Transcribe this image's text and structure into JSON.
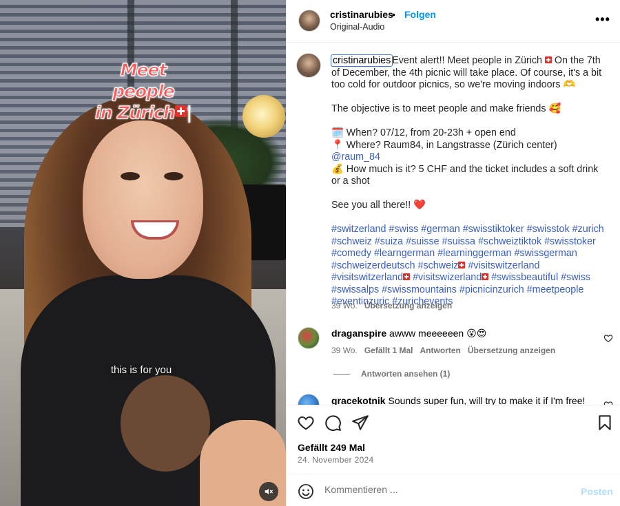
{
  "video": {
    "overlay_title_line1": "Meet people",
    "overlay_title_line2": "in Zürich",
    "overlay_title_suffix": "|",
    "subtitle": "this is for you",
    "mute_icon": "speaker-muted-icon"
  },
  "header": {
    "username": "cristinarubies",
    "separator": "•",
    "follow_label": "Folgen",
    "audio_label": "Original-Audio",
    "more_label": "•••"
  },
  "caption": {
    "username": "cristinarubies",
    "p1_a": "Event alert!! Meet people in Zürich ",
    "p1_b": " On the 7th of December, the 4th picnic will take place. Of course, it's a bit too cold for outdoor picnics, so we're moving indoors 🫶",
    "p2": "The objective is to meet people and make friends 🥰",
    "when": "🗓️ When? 07/12, from 20-23h + open end",
    "where_a": "📍 Where? Raum84, in Langstrasse (Zürich center) ",
    "where_mention": "@raum_84",
    "cost": "💰 How much is it? 5 CHF and the ticket includes a soft drink or a shot",
    "p4": "See you all there!! ❤️",
    "hashtags_1": "#switzerland #swiss #german #swisstiktoker #swisstok #zurich #schweiz #suiza #suisse #suissa #schweiztiktok #swisstoker #comedy #learngerman #learninggerman #swissgerman #schweizerdeutsch #schweiz",
    "hashtags_2": "#visitswitzerland #visitswitzerland",
    "hashtags_3": "#visitswizerland",
    "hashtags_4": "#swissbeautiful #swiss #swissalps #swissmountains #picnicinzurich #meetpeople #eventinzuric #zurichevents",
    "age": "39 Wo.",
    "translate": "Übersetzung anzeigen"
  },
  "comments": [
    {
      "username": "draganspire",
      "text": "awww meeeeeen 😮😍",
      "age": "39 Wo.",
      "likes": "Gefällt 1 Mal",
      "reply": "Antworten",
      "translate": "Übersetzung anzeigen",
      "view_replies": "Antworten ansehen (1)"
    },
    {
      "username": "gracekotnik",
      "text": "Sounds super fun, will try to make it if I'm free!"
    }
  ],
  "actions": {
    "like_icon": "heart-icon",
    "comment_icon": "comment-bubble-icon",
    "share_icon": "paper-plane-icon",
    "save_icon": "bookmark-icon",
    "likes_text": "Gefällt 249 Mal",
    "date": "24. November 2024"
  },
  "composer": {
    "placeholder": "Kommentieren ...",
    "post_label": "Posten"
  }
}
